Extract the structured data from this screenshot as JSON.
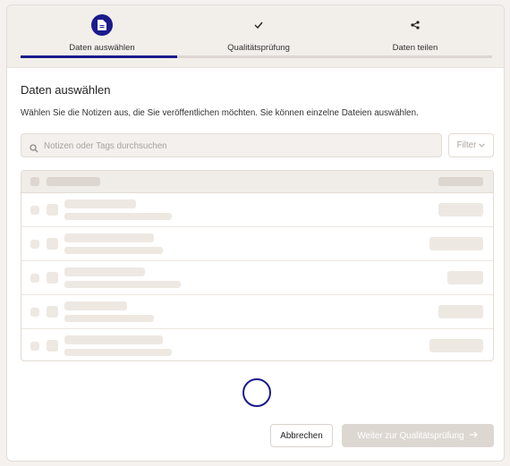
{
  "stepper": {
    "steps": [
      {
        "label": "Daten auswählen",
        "icon": "file-icon",
        "state": "active"
      },
      {
        "label": "Qualitätsprüfung",
        "icon": "check-icon",
        "state": "pending"
      },
      {
        "label": "Daten teilen",
        "icon": "share-icon",
        "state": "pending"
      }
    ],
    "progress_fraction": 0.333
  },
  "main": {
    "title": "Daten auswählen",
    "description": "Wählen Sie die Notizen aus, die Sie veröffentlichen möchten. Sie können einzelne Dateien auswählen."
  },
  "search": {
    "placeholder": "Notizen oder Tags durchsuchen",
    "icon": "search-icon"
  },
  "filter": {
    "label": "Filter"
  },
  "table": {
    "state": "loading",
    "skeleton_rows": 5
  },
  "footer": {
    "cancel_label": "Abbrechen",
    "next_label": "Weiter zur Qualitätsprüfung",
    "next_enabled": false
  },
  "colors": {
    "accent": "#1a1a8c",
    "background": "#f4f1ee",
    "skeleton": "#eee8e3",
    "disabled_button": "#ddd7d2"
  }
}
